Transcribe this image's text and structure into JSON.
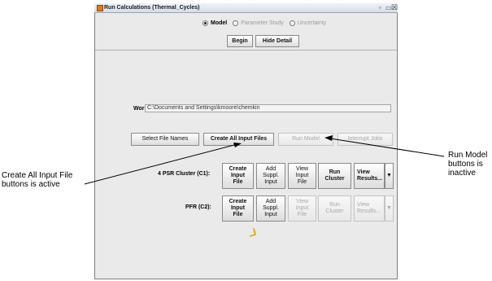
{
  "window": {
    "title": "Run Calculations  (Thermal_Cycles)",
    "controls": [
      "ᵒ",
      "↗",
      "☒"
    ]
  },
  "mode": {
    "options": [
      {
        "label": "Model",
        "selected": true,
        "enabled": true
      },
      {
        "label": "Parameter Study",
        "selected": false,
        "enabled": false
      },
      {
        "label": "Uncertainty",
        "selected": false,
        "enabled": false
      }
    ]
  },
  "top_buttons": {
    "begin": "Begin",
    "hide_detail": "Hide Detail"
  },
  "working_dir": {
    "label": "Working Dir",
    "value": "C:\\Documents and Settings\\kmoore\\chemkin"
  },
  "main_buttons": {
    "select_file_names": "Select File Names",
    "create_all_input_files": "Create All Input Files",
    "run_model": "Run Model",
    "interrupt_jobs": "Interrupt Jobs"
  },
  "clusters": [
    {
      "label": "4 PSR Cluster (C1):",
      "buttons": {
        "create_input_file": "Create\nInput\nFile",
        "add_suppl_input": "Add\nSuppl.\nInput",
        "view_input_file": "View\nInput\nFile",
        "run_cluster": "Run\nCluster",
        "view_results": "View\nResults..."
      },
      "enabled": true
    },
    {
      "label": "PFR (C2):",
      "buttons": {
        "create_input_file": "Create\nInput\nFile",
        "add_suppl_input": "Add\nSuppl.\nInput",
        "view_input_file": "View\nInput\nFile",
        "run_cluster": "Run\nCluster",
        "view_results": "View\nResults..."
      },
      "enabled": false
    }
  ],
  "annotations": {
    "left": "Create All Input File\nbuttons is active",
    "right": "Run Model\nbuttons is\ninactive"
  }
}
